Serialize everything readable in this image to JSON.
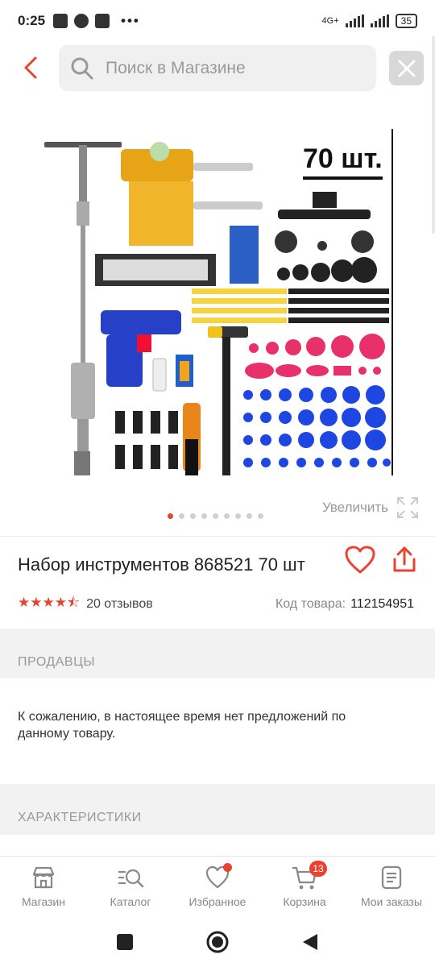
{
  "status_bar": {
    "time": "0:25",
    "network": "4G+",
    "battery": "35"
  },
  "header": {
    "search_placeholder": "Поиск в Магазине"
  },
  "product": {
    "image_overlay_text": "70 шт.",
    "zoom_label": "Увеличить",
    "carousel_count": 9,
    "carousel_active": 0,
    "title": "Набор инструментов 868521 70 шт",
    "rating": 4.5,
    "stars": "★★★★⯪",
    "reviews": "20 отзывов",
    "code_label": "Код товара:",
    "code_value": "112154951"
  },
  "sellers": {
    "heading": "ПРОДАВЦЫ",
    "notice": "К сожалению, в настоящее время нет предложений по данному товару."
  },
  "specs": {
    "heading": "ХАРАКТЕРИСТИКИ"
  },
  "bottom_nav": {
    "items": [
      {
        "label": "Магазин",
        "icon": "store-icon"
      },
      {
        "label": "Каталог",
        "icon": "catalog-search-icon"
      },
      {
        "label": "Избранное",
        "icon": "heart-icon"
      },
      {
        "label": "Корзина",
        "icon": "cart-icon",
        "badge": "13"
      },
      {
        "label": "Мои заказы",
        "icon": "orders-icon"
      }
    ]
  },
  "colors": {
    "accent": "#e8432f",
    "muted": "#999999"
  }
}
